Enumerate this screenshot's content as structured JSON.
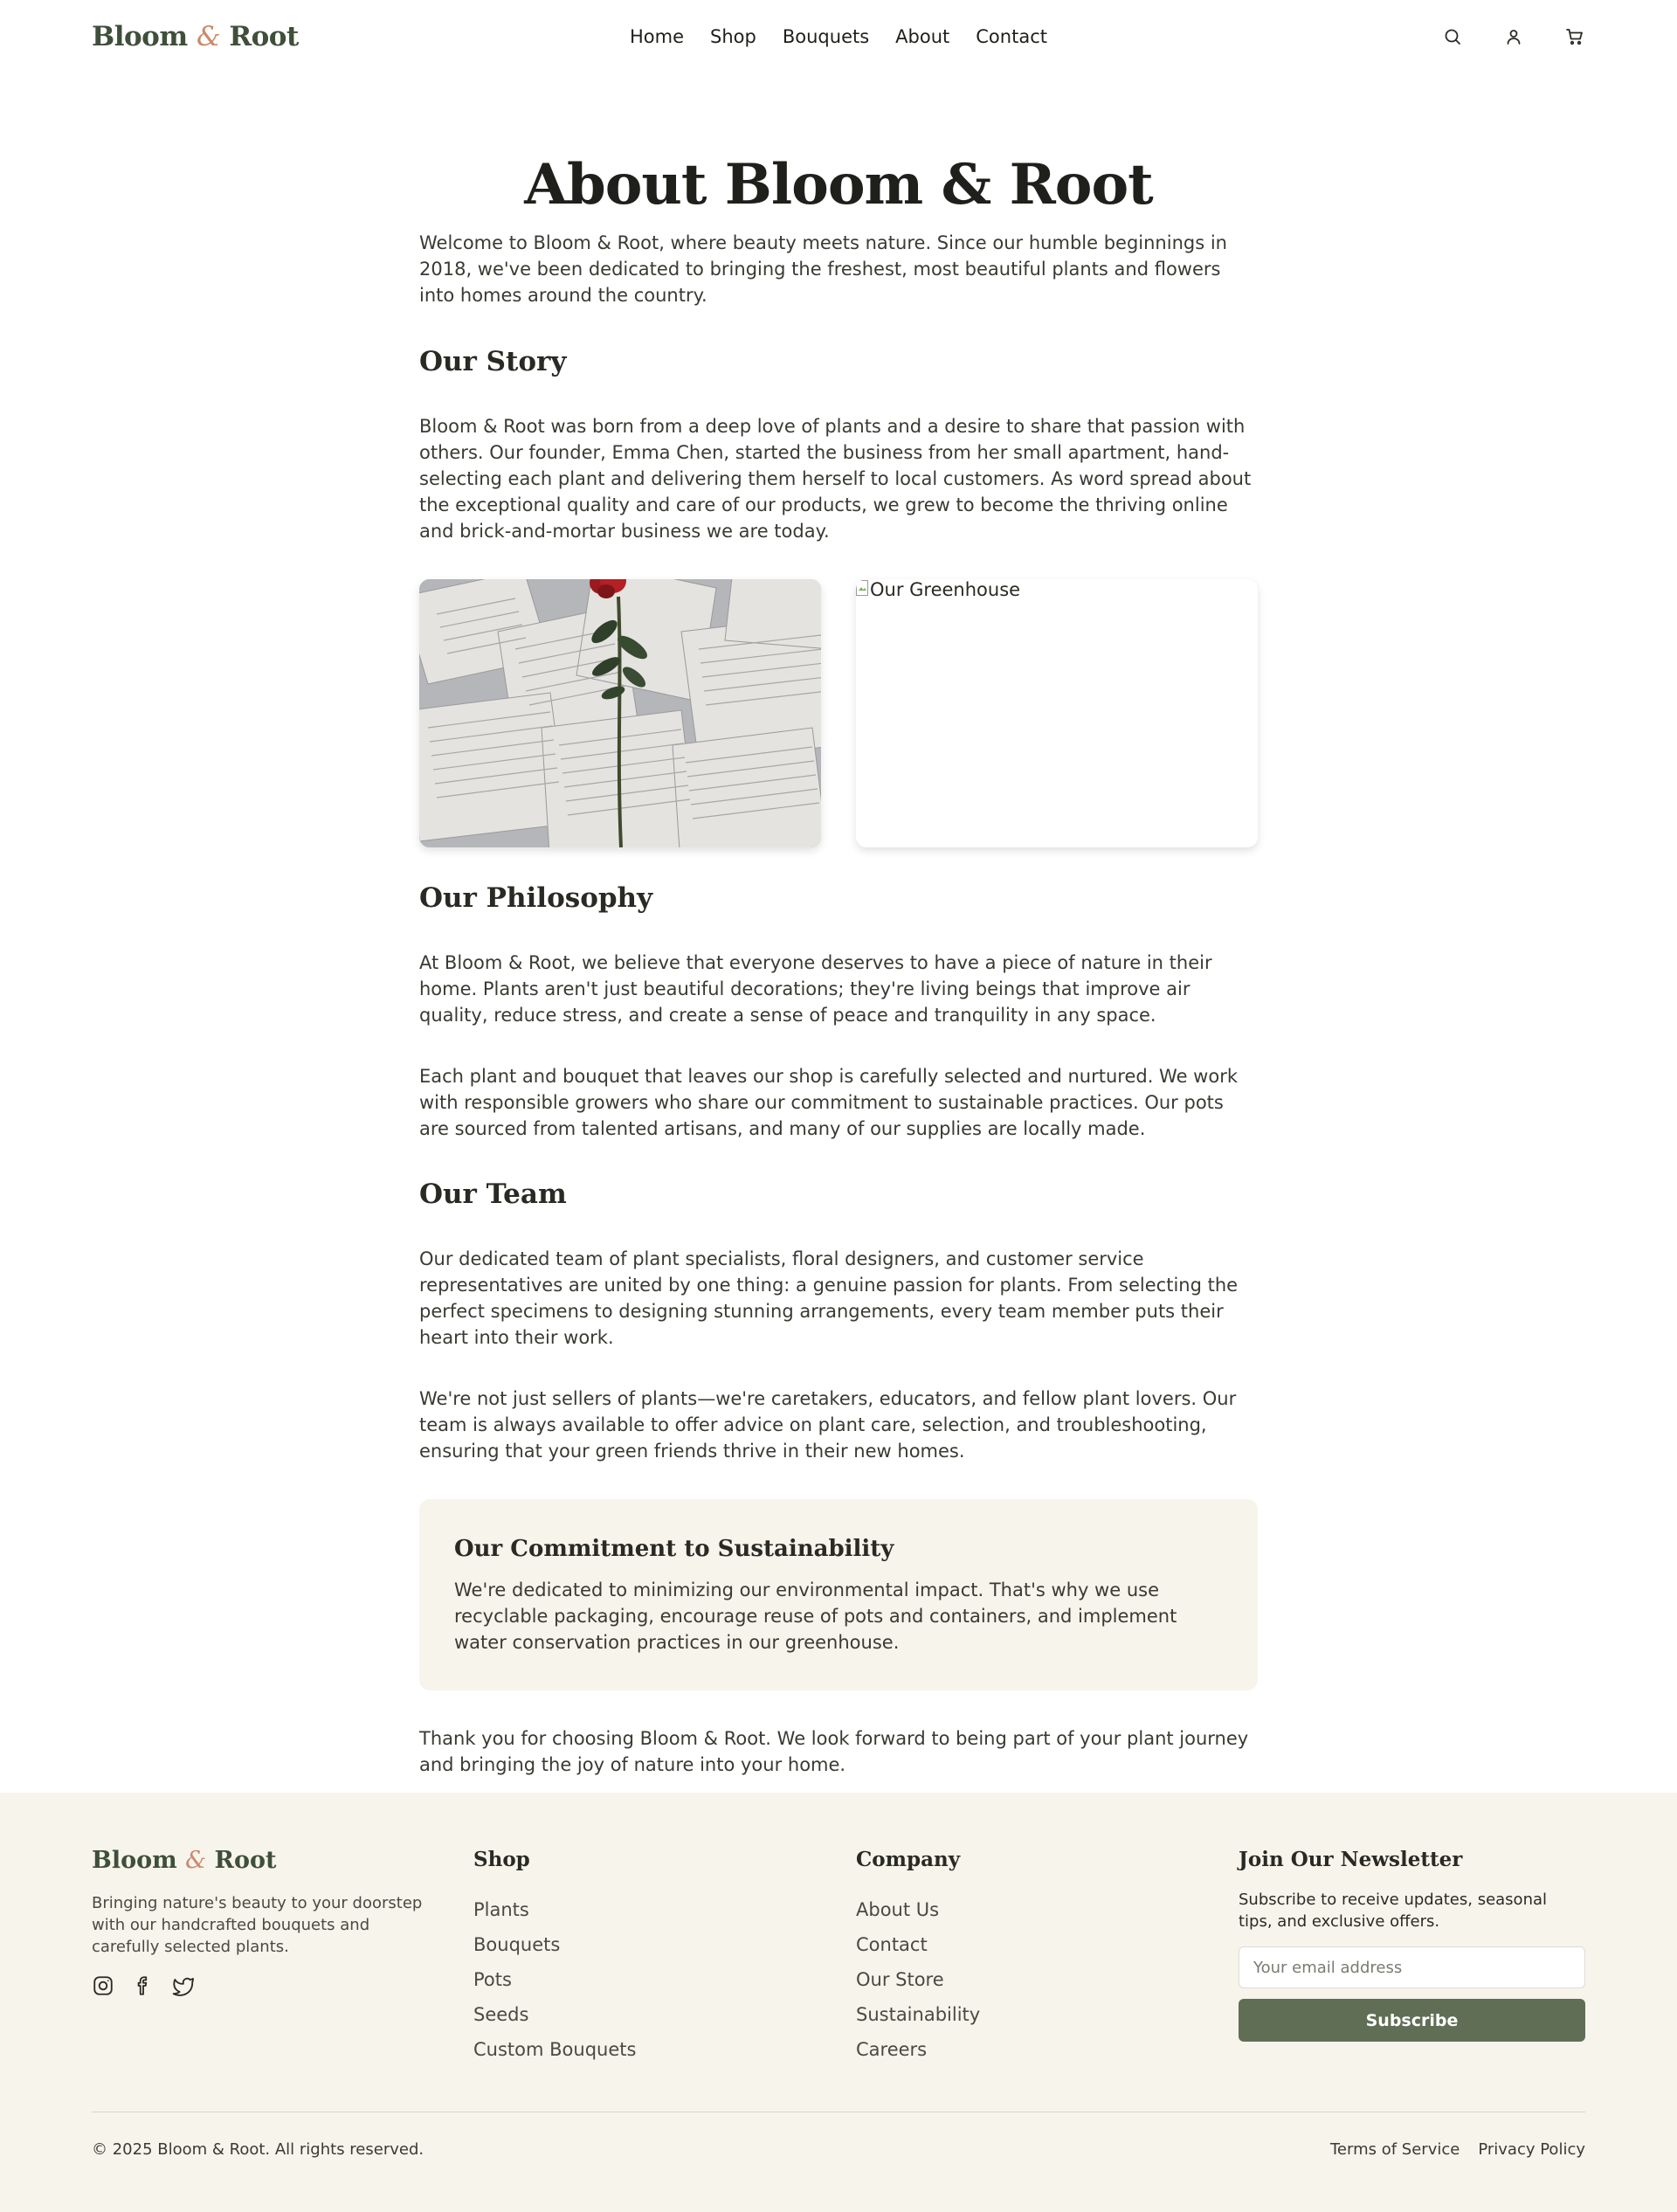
{
  "brand": {
    "name_start": "Bloom",
    "amp": "&",
    "name_end": "Root",
    "accent_color": "#c98a6a",
    "brand_color": "#3f4f3a"
  },
  "nav": {
    "items": [
      "Home",
      "Shop",
      "Bouquets",
      "About",
      "Contact"
    ]
  },
  "header_icons": [
    "search-icon",
    "user-icon",
    "cart-icon"
  ],
  "main": {
    "title": "About Bloom & Root",
    "intro": "Welcome to Bloom & Root, where beauty meets nature. Since our humble beginnings in 2018, we've been dedicated to bringing the freshest, most beautiful plants and flowers into homes around the country.",
    "story_heading": "Our Story",
    "story_text": "Bloom & Root was born from a deep love of plants and a desire to share that passion with others. Our founder, Emma Chen, started the business from her small apartment, hand-selecting each plant and delivering them herself to local customers. As word spread about the exceptional quality and care of our products, we grew to become the thriving online and brick-and-mortar business we are today.",
    "image_alt_greenhouse": "Our Greenhouse",
    "philosophy_heading": "Our Philosophy",
    "philosophy_p1": "At Bloom & Root, we believe that everyone deserves to have a piece of nature in their home. Plants aren't just beautiful decorations; they're living beings that improve air quality, reduce stress, and create a sense of peace and tranquility in any space.",
    "philosophy_p2": "Each plant and bouquet that leaves our shop is carefully selected and nurtured. We work with responsible growers who share our commitment to sustainable practices. Our pots are sourced from talented artisans, and many of our supplies are locally made.",
    "team_heading": "Our Team",
    "team_p1": "Our dedicated team of plant specialists, floral designers, and customer service representatives are united by one thing: a genuine passion for plants. From selecting the perfect specimens to designing stunning arrangements, every team member puts their heart into their work.",
    "team_p2": "We're not just sellers of plants—we're caretakers, educators, and fellow plant lovers. Our team is always available to offer advice on plant care, selection, and troubleshooting, ensuring that your green friends thrive in their new homes.",
    "commitment_heading": "Our Commitment to Sustainability",
    "commitment_text": "We're dedicated to minimizing our environmental impact. That's why we use recyclable packaging, encourage reuse of pots and containers, and implement water conservation practices in our greenhouse.",
    "closing": "Thank you for choosing Bloom & Root. We look forward to being part of your plant journey and bringing the joy of nature into your home."
  },
  "footer": {
    "tagline": "Bringing nature's beauty to your doorstep with our handcrafted bouquets and carefully selected plants.",
    "social_icons": [
      "instagram-icon",
      "facebook-icon",
      "twitter-icon"
    ],
    "shop_heading": "Shop",
    "shop_links": [
      "Plants",
      "Bouquets",
      "Pots",
      "Seeds",
      "Custom Bouquets"
    ],
    "company_heading": "Company",
    "company_links": [
      "About Us",
      "Contact",
      "Our Store",
      "Sustainability",
      "Careers"
    ],
    "newsletter_heading": "Join Our Newsletter",
    "newsletter_text": "Subscribe to receive updates, seasonal tips, and exclusive offers.",
    "email_placeholder": "Your email address",
    "subscribe_label": "Subscribe",
    "button_color": "#606e56",
    "copyright": "© 2025 Bloom & Root. All rights reserved.",
    "legal_links": [
      "Terms of Service",
      "Privacy Policy"
    ]
  }
}
